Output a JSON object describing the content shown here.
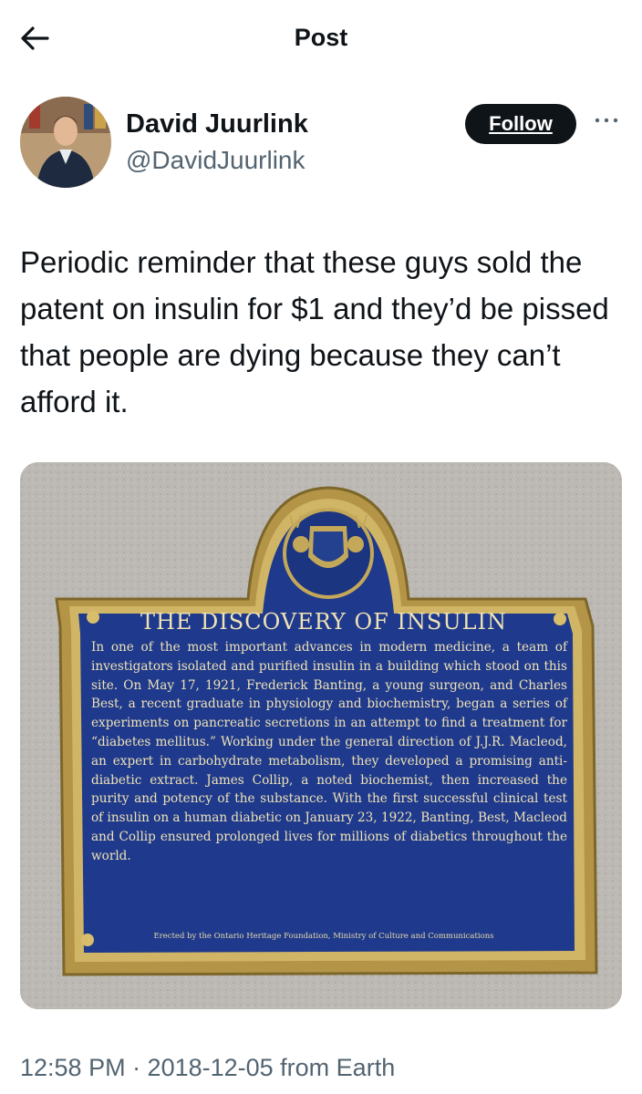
{
  "header": {
    "title": "Post",
    "back_icon": "arrow-left-icon"
  },
  "author": {
    "name": "David Juurlink",
    "handle": "@DavidJuurlink",
    "follow_label": "Follow",
    "more_icon": "more-dots-icon"
  },
  "post": {
    "text": "Periodic reminder that these guys sold the patent on insulin for $1 and they’d be pissed that people are dying because they can’t afford it."
  },
  "plaque": {
    "title": "THE DISCOVERY OF INSULIN",
    "body": "In one of the most important advances in modern medicine, a team of investigators isolated and purified insulin in a building which stood on this site. On May 17, 1921, Frederick Banting, a young surgeon, and Charles Best, a recent graduate in physiology and biochemistry, began a series of experiments on pancreatic secretions in an attempt to find a treatment for “diabetes mellitus.” Working under the general direction of J.J.R. Macleod, an expert in carbohydrate metabolism, they developed a promising anti-diabetic extract. James Collip, a noted biochemist, then increased the purity and potency of the substance. With the first successful clinical test of insulin on a human diabetic on January 23, 1922, Banting, Best, Macleod and Collip ensured prolonged lives for millions of diabetics throughout the world.",
    "credit": "Erected by the Ontario Heritage Foundation, Ministry of Culture and Communications"
  },
  "meta": {
    "timestamp": "12:58 PM · 2018-12-05 from Earth"
  },
  "colors": {
    "text": "#0f1419",
    "secondary": "#536471",
    "plaque_blue": "#1f3a8c",
    "plaque_gold": "#c4a85a"
  }
}
